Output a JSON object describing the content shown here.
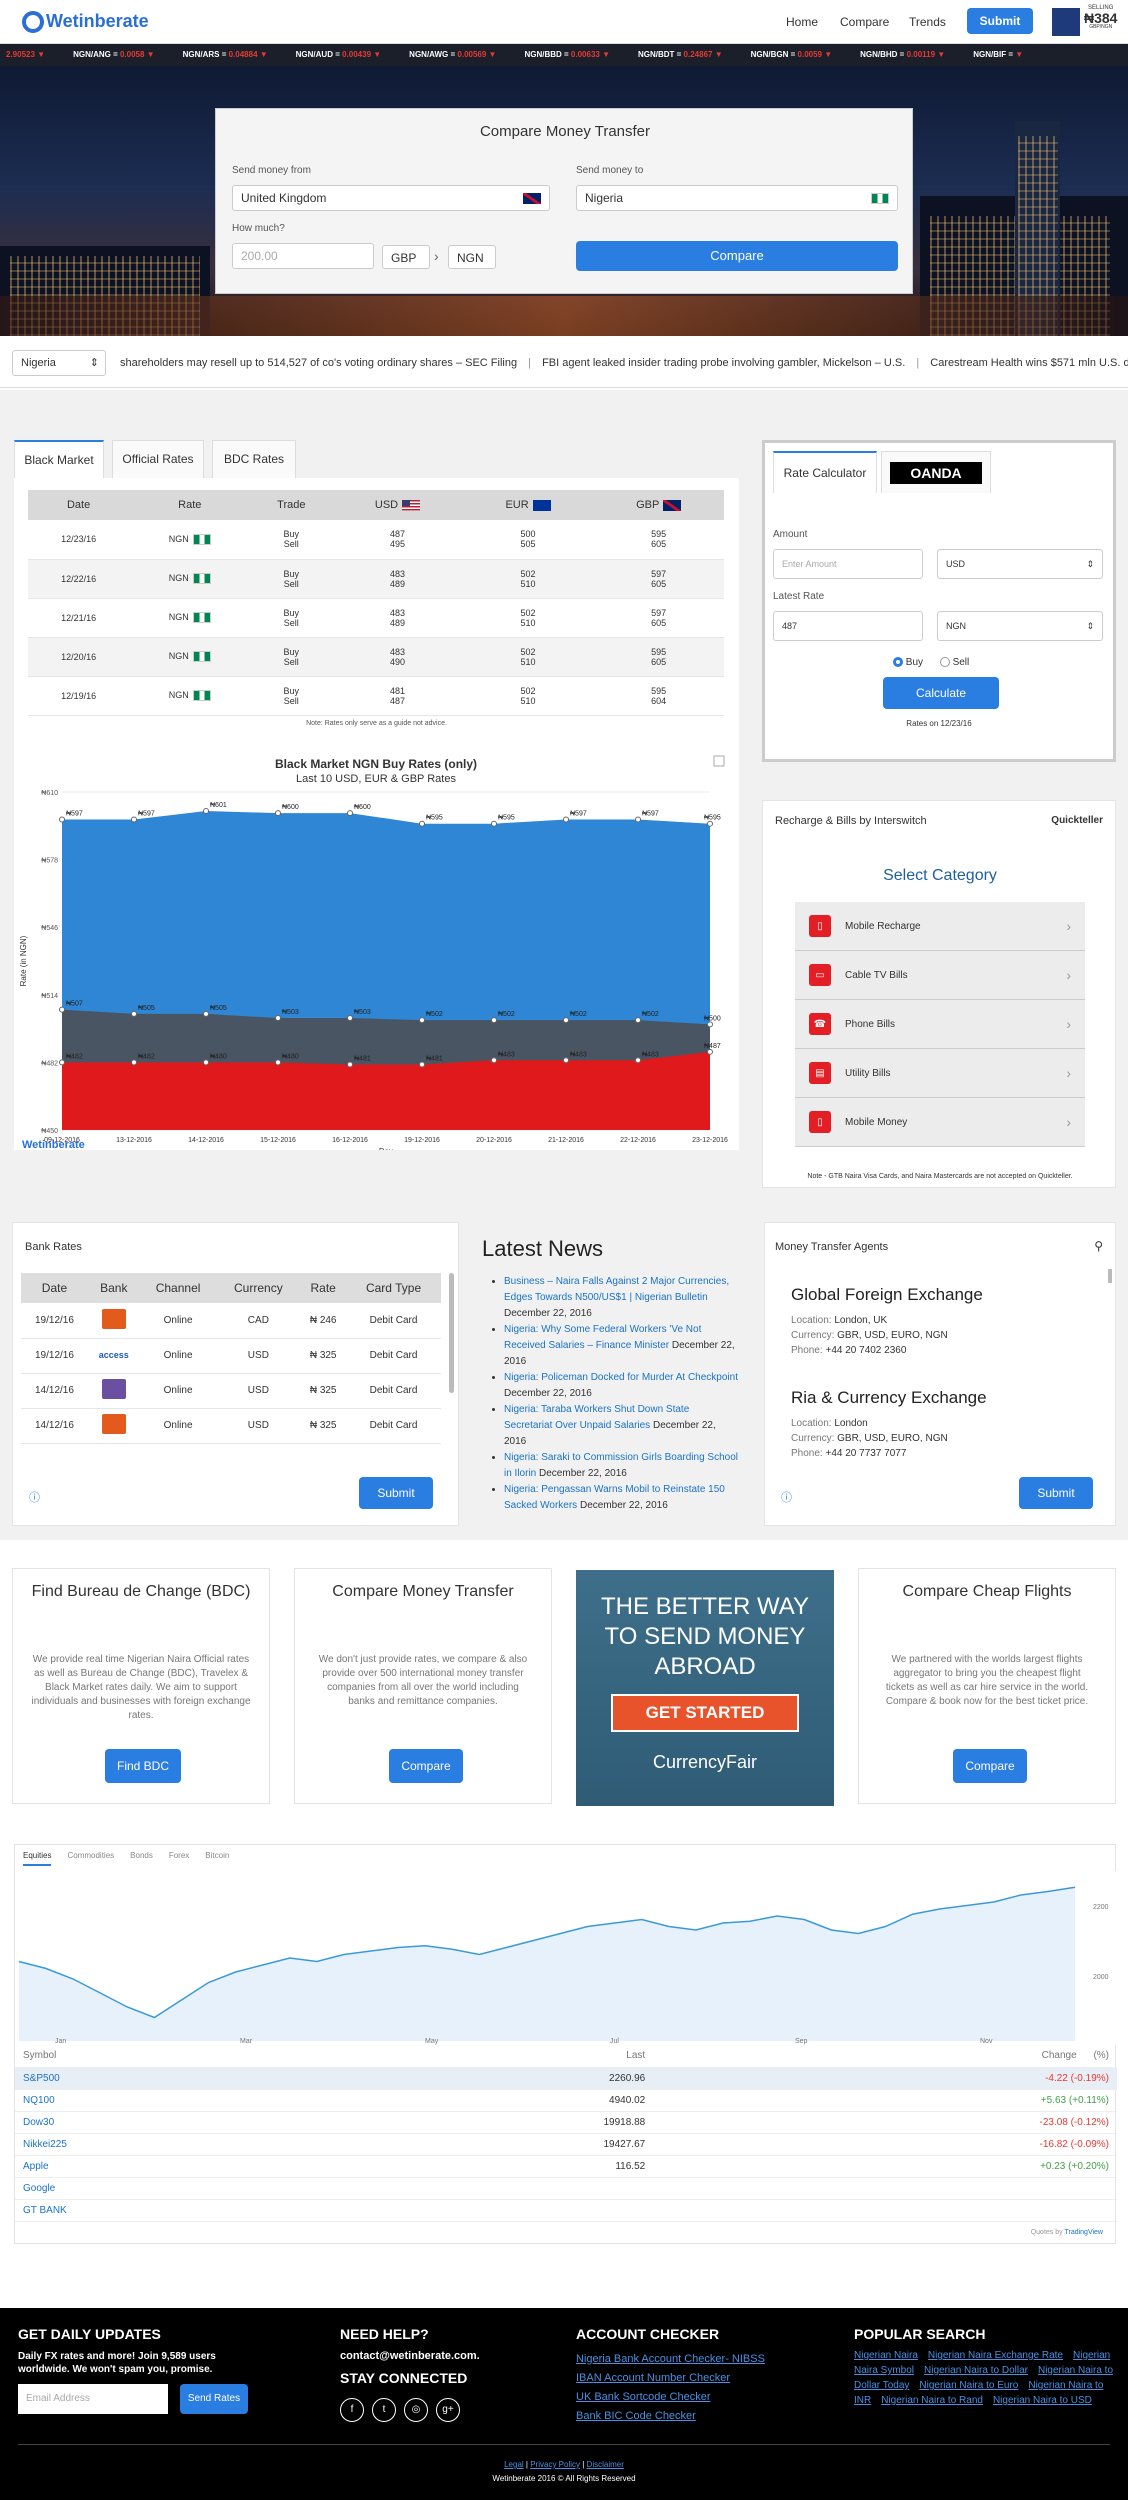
{
  "header": {
    "logo": "Wetinberate",
    "nav": [
      "Home",
      "Compare",
      "Trends"
    ],
    "submit_label": "Submit",
    "badge_top": "SELLING",
    "badge_value": "₦384",
    "badge_sub": "GBP/NGN"
  },
  "ticker": [
    {
      "pair": "",
      "value": "2.90523"
    },
    {
      "pair": "NGN/ANG =",
      "value": "0.0058"
    },
    {
      "pair": "NGN/ARS =",
      "value": "0.04884"
    },
    {
      "pair": "NGN/AUD =",
      "value": "0.00439"
    },
    {
      "pair": "NGN/AWG =",
      "value": "0.00569"
    },
    {
      "pair": "NGN/BBD =",
      "value": "0.00633"
    },
    {
      "pair": "NGN/BDT =",
      "value": "0.24867"
    },
    {
      "pair": "NGN/BGN =",
      "value": "0.0059"
    },
    {
      "pair": "NGN/BHD =",
      "value": "0.00119"
    },
    {
      "pair": "NGN/BIF =",
      "value": ""
    }
  ],
  "compare": {
    "title": "Compare Money Transfer",
    "from_label": "Send money from",
    "from_value": "United Kingdom",
    "to_label": "Send money to",
    "to_value": "Nigeria",
    "amount_label": "How much?",
    "amount_placeholder": "200.00",
    "from_currency": "GBP",
    "to_currency": "NGN",
    "button": "Compare"
  },
  "newsbar": {
    "country": "Nigeria",
    "headlines": [
      "shareholders may resell up to 514,527 of co's voting ordinary shares – SEC Filing",
      "FBI agent leaked insider trading probe involving gambler, Mickelson – U.S.",
      "Carestream Health wins $571 mln U.S. defense contra"
    ]
  },
  "rates_tabs": [
    "Black Market",
    "Official Rates",
    "BDC Rates"
  ],
  "rates_table": {
    "headers": [
      "Date",
      "Rate",
      "Trade",
      "USD",
      "EUR",
      "GBP"
    ],
    "rows": [
      {
        "date": "12/23/16",
        "rate": "NGN",
        "buy": [
          "Buy",
          "487",
          "500",
          "595"
        ],
        "sell": [
          "Sell",
          "495",
          "505",
          "605"
        ]
      },
      {
        "date": "12/22/16",
        "rate": "NGN",
        "buy": [
          "Buy",
          "483",
          "502",
          "597"
        ],
        "sell": [
          "Sell",
          "489",
          "510",
          "605"
        ]
      },
      {
        "date": "12/21/16",
        "rate": "NGN",
        "buy": [
          "Buy",
          "483",
          "502",
          "597"
        ],
        "sell": [
          "Sell",
          "489",
          "510",
          "605"
        ]
      },
      {
        "date": "12/20/16",
        "rate": "NGN",
        "buy": [
          "Buy",
          "483",
          "502",
          "595"
        ],
        "sell": [
          "Sell",
          "490",
          "510",
          "605"
        ]
      },
      {
        "date": "12/19/16",
        "rate": "NGN",
        "buy": [
          "Buy",
          "481",
          "502",
          "595"
        ],
        "sell": [
          "Sell",
          "487",
          "510",
          "604"
        ]
      }
    ],
    "note": "Note: Rates only serve as a guide not advice."
  },
  "calculator": {
    "tab1": "Rate Calculator",
    "tab2": "OANDA",
    "amount_label": "Amount",
    "amount_placeholder": "Enter Amount",
    "amount_currency": "USD",
    "latest_label": "Latest Rate",
    "latest_value": "487",
    "latest_currency": "NGN",
    "buy": "Buy",
    "sell": "Sell",
    "button": "Calculate",
    "rates_on": "Rates on 12/23/16"
  },
  "chart_data": {
    "type": "area",
    "title": "Black Market NGN Buy Rates (only)",
    "subtitle": "Last 10 USD, EUR & GBP Rates",
    "xlabel": "Day",
    "ylabel": "Rate (in NGN)",
    "categories": [
      "09-12-2016",
      "13-12-2016",
      "14-12-2016",
      "15-12-2016",
      "16-12-2016",
      "19-12-2016",
      "20-12-2016",
      "21-12-2016",
      "22-12-2016",
      "23-12-2016"
    ],
    "yticks": [
      "₦450",
      "₦482",
      "₦514",
      "₦546",
      "₦578",
      "₦610"
    ],
    "ylim": [
      450,
      610
    ],
    "series": [
      {
        "name": "GBP BUY",
        "color": "#2f86d4",
        "values": [
          597,
          597,
          601,
          600,
          600,
          595,
          595,
          597,
          597,
          595
        ]
      },
      {
        "name": "EUR BUY",
        "color": "#4a5563",
        "values": [
          507,
          505,
          505,
          503,
          503,
          502,
          502,
          502,
          502,
          500
        ]
      },
      {
        "name": "USD BUY",
        "color": "#e0191c",
        "values": [
          482,
          482,
          482,
          482,
          481,
          481,
          483,
          483,
          483,
          487
        ]
      }
    ],
    "labels": {
      "gbp": [
        "₦597",
        "₦597",
        "₦601",
        "₦600",
        "₦600",
        "₦595",
        "₦595",
        "₦597",
        "₦597",
        "₦595"
      ],
      "eur": [
        "₦507",
        "₦505",
        "₦505",
        "₦503",
        "₦503",
        "₦502",
        "₦502",
        "₦502",
        "₦502",
        "₦500"
      ],
      "usd": [
        "₦482",
        "₦482",
        "₦480",
        "₦480",
        "₦481",
        "₦481",
        "₦483",
        "₦483",
        "₦483",
        "₦487"
      ]
    },
    "legend": "bottom",
    "brand": "Wetinberate"
  },
  "recharge": {
    "title": "Recharge & Bills by Interswitch",
    "brand": "Quickteller",
    "heading": "Select Category",
    "items": [
      "Mobile Recharge",
      "Cable TV Bills",
      "Phone Bills",
      "Utility Bills",
      "Mobile Money"
    ],
    "note": "Note - GTB Naira Visa Cards, and Naira Mastercards are not accepted on Quickteller."
  },
  "bank_rates": {
    "title": "Bank Rates",
    "headers": [
      "Date",
      "Bank",
      "Channel",
      "Currency",
      "Rate",
      "Card Type"
    ],
    "rows": [
      {
        "date": "19/12/16",
        "bank": "",
        "channel": "Online",
        "currency": "CAD",
        "rate": "₦ 246",
        "card": "Debit Card"
      },
      {
        "date": "19/12/16",
        "bank": "access",
        "channel": "Online",
        "currency": "USD",
        "rate": "₦ 325",
        "card": "Debit Card"
      },
      {
        "date": "14/12/16",
        "bank": "",
        "channel": "Online",
        "currency": "USD",
        "rate": "₦ 325",
        "card": "Debit Card"
      },
      {
        "date": "14/12/16",
        "bank": "",
        "channel": "Online",
        "currency": "USD",
        "rate": "₦ 325",
        "card": "Debit Card"
      }
    ],
    "button": "Submit"
  },
  "news": {
    "title": "Latest News",
    "items": [
      {
        "link": "Business – Naira Falls Against 2 Major Currencies, Edges Towards N500/US$1 | Nigerian Bulletin",
        "date": "December 22, 2016"
      },
      {
        "link": "Nigeria: Why Some Federal Workers 'Ve Not Received Salaries – Finance Minister",
        "date": "December 22, 2016"
      },
      {
        "link": "Nigeria: Policeman Docked for Murder At Checkpoint",
        "date": "December 22, 2016"
      },
      {
        "link": "Nigeria: Taraba Workers Shut Down State Secretariat Over Unpaid Salaries",
        "date": "December 22, 2016"
      },
      {
        "link": "Nigeria: Saraki to Commission Girls Boarding School in Ilorin",
        "date": "December 22, 2016"
      },
      {
        "link": "Nigeria: Pengassan Warns Mobil to Reinstate 150 Sacked Workers",
        "date": "December 22, 2016"
      }
    ]
  },
  "agents": {
    "title": "Money Transfer Agents",
    "items": [
      {
        "name": "Global Foreign Exchange",
        "location": "London, UK",
        "currency": "GBR, USD, EURO, NGN",
        "phone": "+44 20 7402 2360"
      },
      {
        "name": "Ria & Currency Exchange",
        "location": "London",
        "currency": "GBR, USD, EURO, NGN",
        "phone": "+44 20 7737 7077"
      }
    ],
    "location_label": "Location:",
    "currency_label": "Currency:",
    "phone_label": "Phone:",
    "button": "Submit"
  },
  "features": [
    {
      "title": "Find Bureau de Change (BDC)",
      "text": "We provide real time Nigerian Naira Official rates as well as Bureau de Change (BDC), Travelex & Black Market rates daily. We aim to support individuals and businesses with foreign exchange rates.",
      "button": "Find BDC"
    },
    {
      "title": "Compare Money Transfer",
      "text": "We don't just provide rates, we compare & also provide over 500 international money transfer companies from all over the world including banks and remittance companies.",
      "button": "Compare"
    },
    {
      "title": "Compare Cheap Flights",
      "text": "We partnered with the worlds largest flights aggregator to bring you the cheapest flight tickets as well as car hire service in the world. Compare & book now for the best ticket price.",
      "button": "Compare"
    }
  ],
  "ad": {
    "line1": "THE BETTER WAY",
    "line2": "TO SEND MONEY",
    "line3": "ABROAD",
    "cta": "GET STARTED",
    "brand": "CurrencyFair"
  },
  "markets": {
    "tabs": [
      "Equities",
      "Commodities",
      "Bonds",
      "Forex",
      "Bitcoin"
    ],
    "months": [
      "Jan",
      "Mar",
      "May",
      "Jul",
      "Sep",
      "Nov"
    ],
    "yaxis": [
      "2200",
      "2000"
    ],
    "headers": {
      "symbol": "Symbol",
      "last": "Last",
      "change": "Change",
      "pct": "(%)"
    },
    "rows": [
      {
        "symbol": "S&P500",
        "last": "2260.96",
        "change": "-4.22 (-0.19%)",
        "dir": "neg"
      },
      {
        "symbol": "NQ100",
        "last": "4940.02",
        "change": "+5.63 (+0.11%)",
        "dir": "pos"
      },
      {
        "symbol": "Dow30",
        "last": "19918.88",
        "change": "-23.08 (-0.12%)",
        "dir": "neg"
      },
      {
        "symbol": "Nikkei225",
        "last": "19427.67",
        "change": "-16.82 (-0.09%)",
        "dir": "neg"
      },
      {
        "symbol": "Apple",
        "last": "116.52",
        "change": "+0.23 (+0.20%)",
        "dir": "pos"
      },
      {
        "symbol": "Google",
        "last": "",
        "change": "",
        "dir": ""
      },
      {
        "symbol": "GT BANK",
        "last": "",
        "change": "",
        "dir": ""
      }
    ],
    "quotes_by": "Quotes by",
    "tv": "TradingView"
  },
  "footer": {
    "updates_title": "GET DAILY UPDATES",
    "updates_text": "Daily FX rates and more! Join 9,589 users worldwide. We won't spam you, promise.",
    "email_placeholder": "Email Address",
    "send_button": "Send Rates",
    "help_title": "NEED HELP?",
    "email": "contact@wetinberate.com.",
    "stay": "STAY CONNECTED",
    "checker_title": "ACCOUNT CHECKER",
    "checker_links": [
      "Nigeria Bank Account Checker- NIBSS",
      "IBAN Account Number Checker",
      "UK Bank Sortcode Checker",
      "Bank BIC Code Checker"
    ],
    "popular_title": "POPULAR SEARCH",
    "popular_links": [
      "Nigerian Naira",
      "Nigerian Naira Exchange Rate",
      "Nigerian Naira Symbol",
      "Nigerian Naira to Dollar",
      "Nigerian Naira to Dollar Today",
      "Nigerian Naira to Euro",
      "Nigerian Naira to INR",
      "Nigerian Naira to Rand",
      "Nigerian Naira to USD"
    ],
    "legal": "Legal",
    "privacy": "Privacy Policy",
    "disclaimer": "Disclaimer",
    "copyright": "Wetinberate 2016 © All Rights Reserved"
  }
}
